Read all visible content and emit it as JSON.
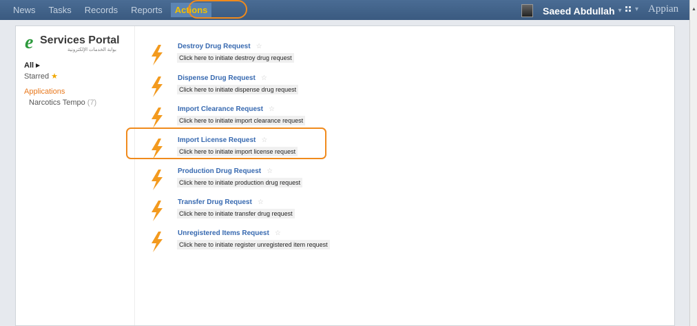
{
  "nav": {
    "items": [
      "News",
      "Tasks",
      "Records",
      "Reports"
    ],
    "active": "Actions"
  },
  "user": {
    "name": "Saeed Abdullah",
    "caret": "▾"
  },
  "brand": {
    "apps_caret": "▾",
    "name": "Appian"
  },
  "sidebar": {
    "logo_text": "Services Portal",
    "logo_arabic": "بوابة الخدمات الإلكترونية",
    "all": "All ▸",
    "starred": "Starred",
    "applications_label": "Applications",
    "app_name": "Narcotics Tempo",
    "app_count": "(7)"
  },
  "actions": [
    {
      "title": "Destroy Drug Request",
      "desc": "Click here to initiate destroy drug request"
    },
    {
      "title": "Dispense Drug Request",
      "desc": "Click here to initiate dispense drug request"
    },
    {
      "title": "Import Clearance Request",
      "desc": "Click here to initiate import clearance request"
    },
    {
      "title": "Import License Request",
      "desc": "Click here to initiate import license request"
    },
    {
      "title": "Production Drug Request",
      "desc": "Click here to initiate production drug request"
    },
    {
      "title": "Transfer Drug Request",
      "desc": "Click here to initiate transfer drug request"
    },
    {
      "title": "Unregistered Items Request",
      "desc": "Click here to initiate register unregistered item request"
    }
  ],
  "colors": {
    "accent": "#f08a1c",
    "link": "#3769b0",
    "topbar": "#3a5a80",
    "active_tab_text": "#f2c100",
    "logo_green": "#2e9a3e"
  }
}
